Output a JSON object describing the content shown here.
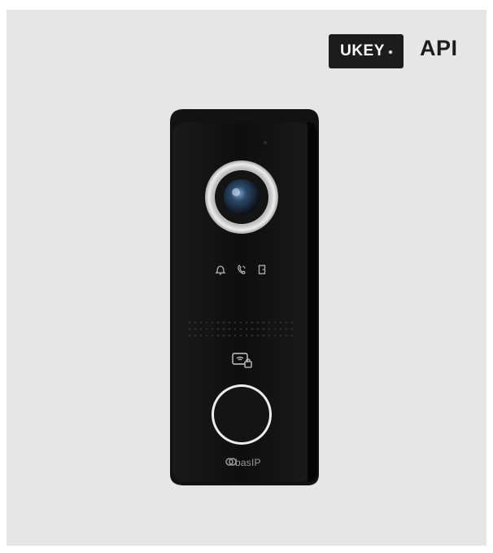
{
  "badge": {
    "label": "UKEY",
    "icon": "dot-icon"
  },
  "api": {
    "label": "API"
  },
  "device": {
    "brand_label": "basIP",
    "indicator_icons": [
      "bell-icon",
      "phone-icon",
      "door-icon"
    ],
    "card_reader_icon": "card-lock-icon",
    "colors": {
      "background": "#e6e6e7",
      "body": "#0f0f0f",
      "ring": "#d9d9d9",
      "lens": "#2c4a6b"
    }
  }
}
